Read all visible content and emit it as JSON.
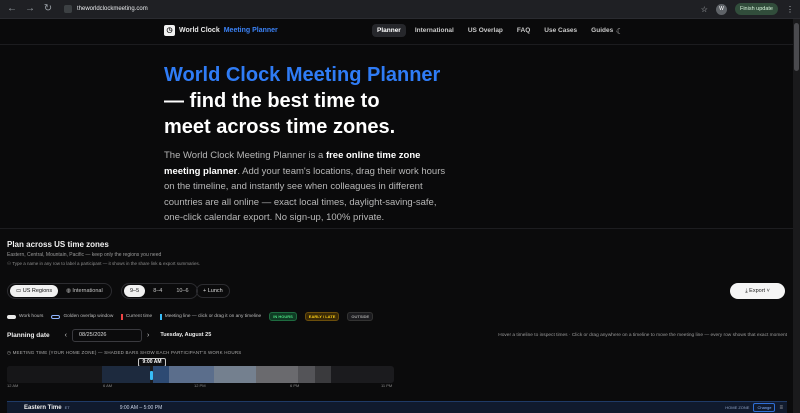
{
  "browser": {
    "url": "theworldclockmeeting.com",
    "profile_initial": "W",
    "update_label": "Finish update"
  },
  "nav": {
    "logo_text": "World Clock",
    "logo_accent": "Meeting Planner",
    "links": [
      "Planner",
      "International",
      "US Overlap",
      "FAQ",
      "Use Cases",
      "Guides"
    ],
    "active": "Planner"
  },
  "hero": {
    "title_accent": "World Clock Meeting Planner",
    "title_line2": "— find the best time to",
    "title_line3": "meet across time zones.",
    "desc_part1": "The World Clock Meeting Planner is a ",
    "desc_bold": "free online time zone meeting planner",
    "desc_part2": ". Add your team's locations, drag their work hours on the timeline, and instantly see when colleagues in different countries are all online — exact local times, daylight-saving-safe, one-click calendar export. No sign-up, 100% private."
  },
  "planner": {
    "title": "Plan across US time zones",
    "subtitle": "Eastern, Central, Mountain, Pacific — keep only the regions you need",
    "hint": "Type a name in any row to label a participant — it shows in the share link & export summaries.",
    "region_options": [
      "US Regions",
      "International"
    ],
    "hours_options": [
      "9–5",
      "8–4",
      "10–6"
    ],
    "lunch_label": "Lunch",
    "export_label": "Export",
    "legend": {
      "work": "Work hours",
      "golden": "Golden overlap window",
      "current": "Current time",
      "meeting": "Meeting line — click or drag it on any timeline",
      "in_hours": "IN HOURS",
      "early_late": "EARLY / LATE",
      "outside": "OUTSIDE"
    },
    "date_label": "Planning date",
    "date_value": "08/25/2026",
    "date_day": "Tuesday, August 25",
    "date_hint": "Hover a timeline to inspect times · Click or drag anywhere on a timeline to move the meeting line — every row shows that exact moment",
    "meeting_time_label": "MEETING TIME (YOUR HOME ZONE) — SHADED BARS SHOW EACH PARTICIPANT'S WORK HOURS",
    "meeting_time": "9:00 AM",
    "ticks": [
      "12 AM",
      "6 AM",
      "12 PM",
      "6 PM",
      "11 PM"
    ],
    "zone": {
      "name": "Eastern Time",
      "abbr": "ET",
      "hours": "9:00 AM – 5:00 PM",
      "home": "HOME ZONE",
      "change": "Change"
    }
  },
  "colors": {
    "accent": "#2f7cf6",
    "meeting_line": "#38bdf8",
    "current_line": "#ef4444"
  }
}
